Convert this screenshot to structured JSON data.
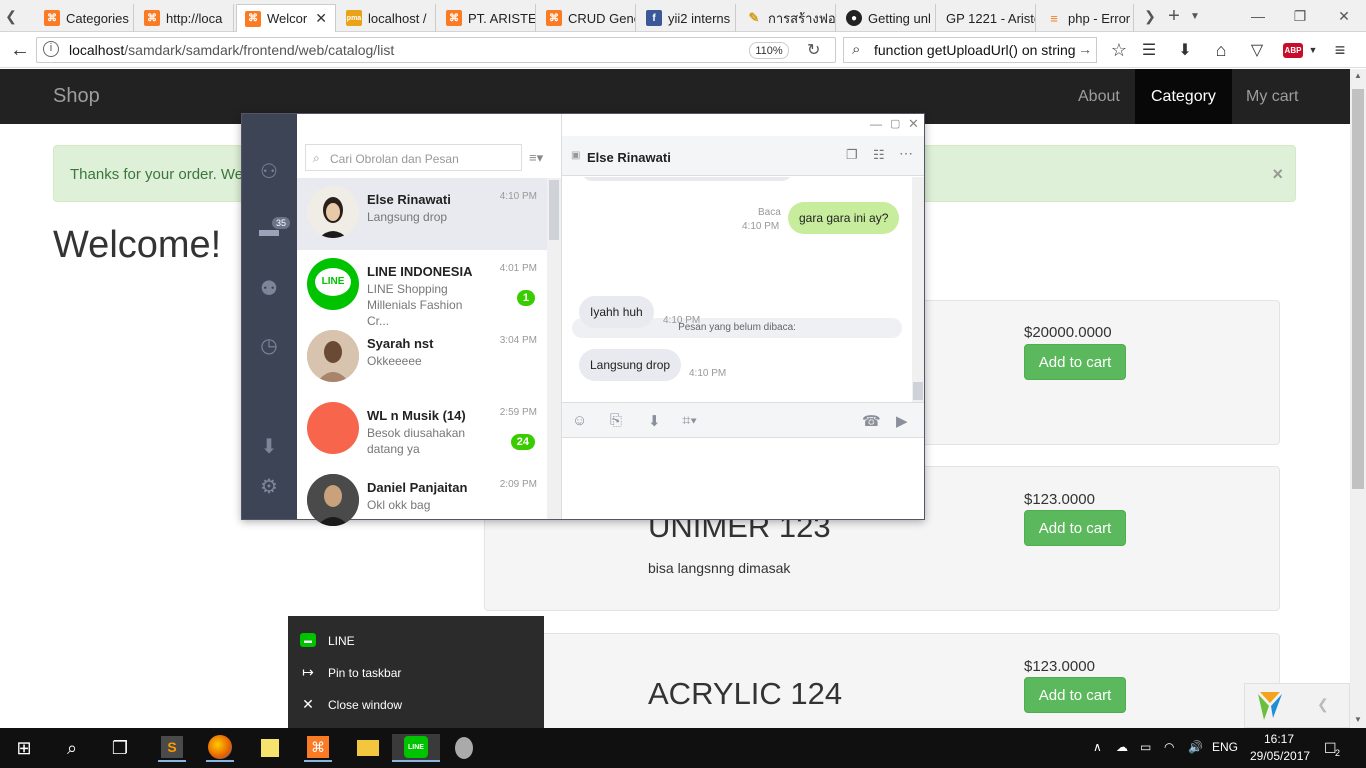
{
  "browser": {
    "tabs": [
      {
        "label": "Categories",
        "icon": "xampp-icon"
      },
      {
        "label": "http://loca",
        "icon": "xampp-icon"
      },
      {
        "label": "Welcor",
        "icon": "xampp-icon",
        "active": true
      },
      {
        "label": "localhost /",
        "icon": "phpmyadmin-icon"
      },
      {
        "label": "PT. ARISTE",
        "icon": "xampp-icon"
      },
      {
        "label": "CRUD Gene",
        "icon": "xampp-icon"
      },
      {
        "label": "yii2 interns",
        "icon": "facebook-icon"
      },
      {
        "label": "การสร้างฟอ",
        "icon": "pencil-icon"
      },
      {
        "label": "Getting unl",
        "icon": "github-icon"
      },
      {
        "label": "GP 1221 - Ariste",
        "icon": "none"
      },
      {
        "label": "php - Error",
        "icon": "stackoverflow-icon"
      }
    ],
    "url_host": "localhost",
    "url_path": "/samdark/samdark/frontend/web/catalog/list",
    "zoom": "110%",
    "search_value": "function getUploadUrl() on string"
  },
  "site": {
    "brand": "Shop",
    "nav": [
      {
        "label": "About",
        "active": false
      },
      {
        "label": "Category",
        "active": true
      },
      {
        "label": "My cart",
        "active": false
      }
    ],
    "alert": "Thanks for your order. We",
    "alert_close": "×",
    "welcome": "Welcome!",
    "products": [
      {
        "name": "",
        "desc": "",
        "price": "$20000.0000",
        "button": "Add to cart"
      },
      {
        "name": "UNIMER 123",
        "desc": "bisa langsnng dimasak",
        "price": "$123.0000",
        "button": "Add to cart"
      },
      {
        "name": "ACRYLIC 124",
        "desc": "",
        "price": "$123.0000",
        "button": "Add to cart"
      }
    ]
  },
  "line": {
    "unread_count": "35",
    "search_placeholder": "Cari Obrolan dan Pesan",
    "chats": [
      {
        "name": "Else Rinawati",
        "message": "Langsung drop",
        "time": "4:10 PM",
        "badge": "",
        "avatar_color": "#f0ece6"
      },
      {
        "name": "LINE INDONESIA",
        "message": "LINE Shopping Millenials Fashion Cr...",
        "time": "4:01 PM",
        "badge": "1",
        "avatar_color": "#00c300"
      },
      {
        "name": "Syarah nst",
        "message": "Okkeeeee",
        "time": "3:04 PM",
        "badge": "",
        "avatar_color": "#b89a80"
      },
      {
        "name": "WL n Musik (14)",
        "message": "Besok diusahakan datang ya",
        "time": "2:59 PM",
        "badge": "24",
        "avatar_color": "#f7654d"
      },
      {
        "name": "Daniel Panjaitan",
        "message": "Okl okk bag",
        "time": "2:09 PM",
        "badge": "",
        "avatar_color": "#3a3a3a"
      }
    ],
    "conversation": {
      "title": "Else Rinawati",
      "sent": {
        "text": "gara gara ini ay?",
        "status": "Baca",
        "time": "4:10 PM"
      },
      "unread_divider": "Pesan yang belum dibaca:",
      "received": [
        {
          "text": "Iyahh huh",
          "time": "4:10 PM"
        },
        {
          "text": "Langsung drop",
          "time": "4:10 PM"
        }
      ]
    }
  },
  "context_menu": {
    "items": [
      {
        "label": "LINE",
        "icon": "line-icon"
      },
      {
        "label": "Pin to taskbar",
        "icon": "pin-icon"
      },
      {
        "label": "Close window",
        "icon": "close-icon"
      }
    ]
  },
  "taskbar": {
    "language": "ENG",
    "time": "16:17",
    "date": "29/05/2017",
    "notifications": "2"
  }
}
